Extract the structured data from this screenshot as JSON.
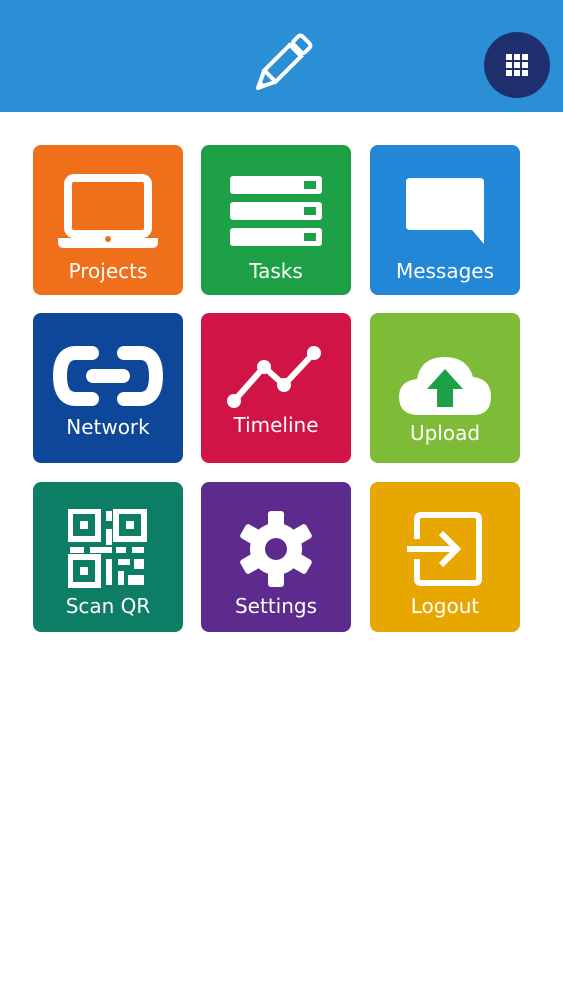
{
  "header": {
    "background_color": "#2b8fd6",
    "logo_icon": "pencil-icon",
    "menu_icon": "grid-icon",
    "menu_button_color": "#1f2f6e"
  },
  "tiles": [
    {
      "label": "Projects",
      "icon": "laptop-icon",
      "color": "#ef6f1a"
    },
    {
      "label": "Tasks",
      "icon": "list-icon",
      "color": "#1ea146"
    },
    {
      "label": "Messages",
      "icon": "chat-bubble-icon",
      "color": "#2187d6"
    },
    {
      "label": "Network",
      "icon": "link-icon",
      "color": "#0e479a"
    },
    {
      "label": "Timeline",
      "icon": "line-chart-icon",
      "color": "#d01446"
    },
    {
      "label": "Upload",
      "icon": "cloud-upload-icon",
      "color": "#7ebb36"
    },
    {
      "label": "Scan QR",
      "icon": "qr-code-icon",
      "color": "#0d7d66"
    },
    {
      "label": "Settings",
      "icon": "gear-icon",
      "color": "#5d2a8d"
    },
    {
      "label": "Logout",
      "icon": "logout-icon",
      "color": "#e8a600"
    }
  ]
}
